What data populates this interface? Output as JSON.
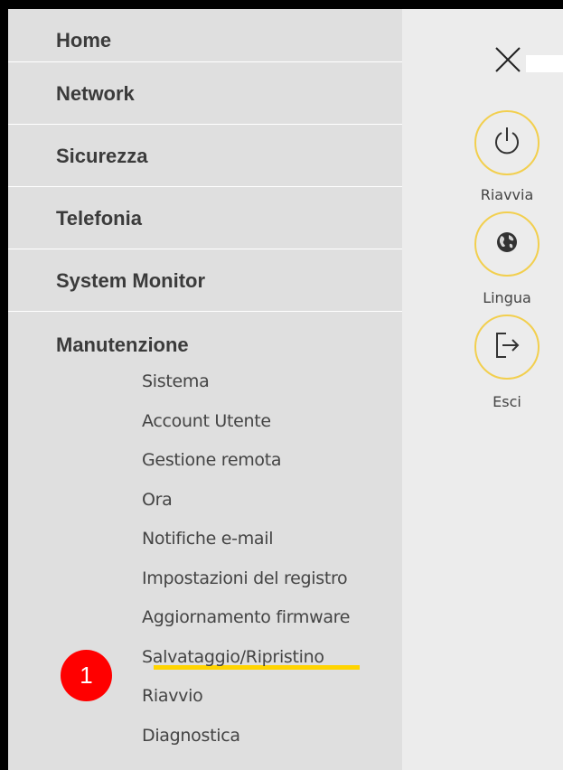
{
  "menu": {
    "items": [
      {
        "label": "Home"
      },
      {
        "label": "Network"
      },
      {
        "label": "Sicurezza"
      },
      {
        "label": "Telefonia"
      },
      {
        "label": "System Monitor"
      },
      {
        "label": "Manutenzione"
      }
    ],
    "submenu": [
      {
        "label": "Sistema"
      },
      {
        "label": "Account Utente"
      },
      {
        "label": "Gestione remota"
      },
      {
        "label": "Ora"
      },
      {
        "label": "Notifiche e-mail"
      },
      {
        "label": "Impostazioni del registro"
      },
      {
        "label": "Aggiornamento firmware"
      },
      {
        "label": "Salvataggio/Ripristino"
      },
      {
        "label": "Riavvio"
      },
      {
        "label": "Diagnostica"
      }
    ]
  },
  "annotation": {
    "number": "1",
    "color": "#ff0000",
    "highlight_color": "#ffd400"
  },
  "actions": {
    "restart_label": "Riavvia",
    "language_label": "Lingua",
    "exit_label": "Esci"
  },
  "icons": {
    "close": "close-icon",
    "restart": "power-icon",
    "language": "globe-icon",
    "exit": "logout-icon"
  },
  "colors": {
    "accent_ring": "#f2cf4e",
    "menu_bg": "#dfdfdf"
  }
}
